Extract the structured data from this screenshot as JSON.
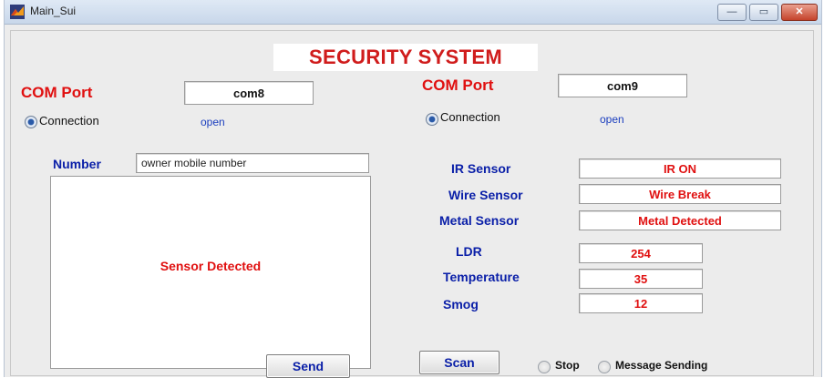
{
  "window": {
    "title": "Main_Sui",
    "minimize_glyph": "—",
    "maximize_glyph": "▭",
    "close_glyph": "✕"
  },
  "header": {
    "title": "SECURITY SYSTEM"
  },
  "left_port": {
    "label": "COM Port",
    "value": "com8",
    "connection_label": "Connection",
    "connection_status": "open"
  },
  "right_port": {
    "label": "COM Port",
    "value": "com9",
    "connection_label": "Connection",
    "connection_status": "open"
  },
  "number": {
    "label": "Number",
    "value": "owner mobile number"
  },
  "sensor_panel": {
    "text": "Sensor Detected"
  },
  "sensors": {
    "ir": {
      "label": "IR Sensor",
      "value": "IR ON"
    },
    "wire": {
      "label": "Wire Sensor",
      "value": "Wire Break"
    },
    "metal": {
      "label": "Metal Sensor",
      "value": "Metal Detected"
    },
    "ldr": {
      "label": "LDR",
      "value": "254"
    },
    "temperature": {
      "label": "Temperature",
      "value": "35"
    },
    "smog": {
      "label": "Smog",
      "value": "12"
    }
  },
  "buttons": {
    "send": "Send",
    "scan": "Scan"
  },
  "options": {
    "stop": "Stop",
    "message_sending": "Message Sending"
  },
  "colors": {
    "accent_red": "#e01010",
    "label_blue": "#0a1fa8"
  }
}
